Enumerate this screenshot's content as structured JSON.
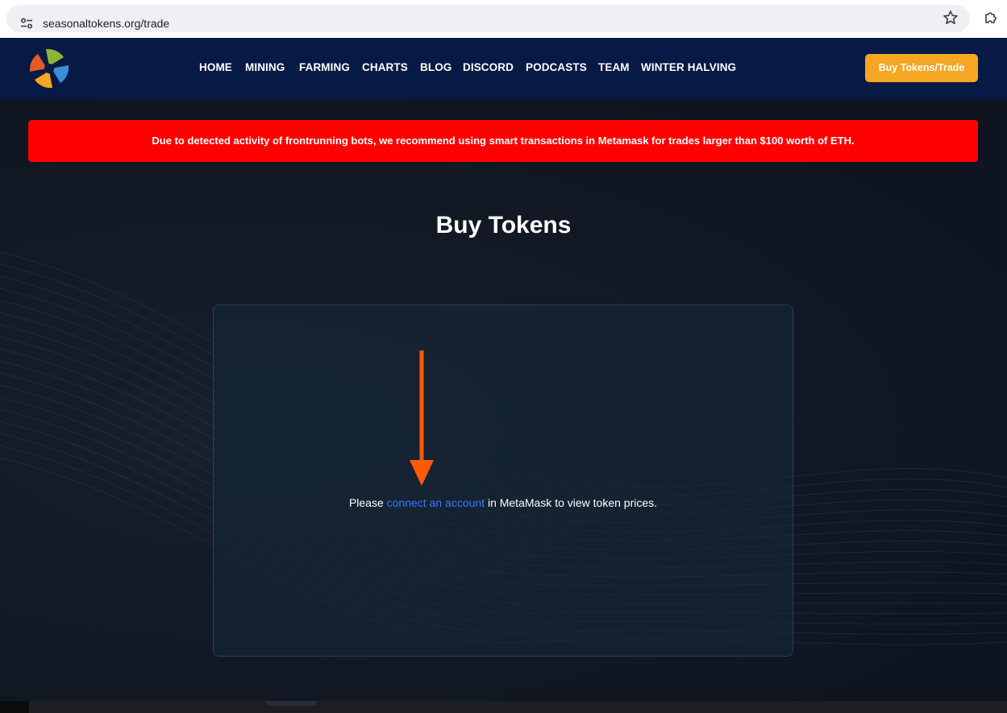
{
  "browser": {
    "url": "seasonaltokens.org/trade"
  },
  "header": {
    "nav": [
      {
        "label": "HOME"
      },
      {
        "label": "MINING"
      },
      {
        "label": "FARMING"
      },
      {
        "label": "CHARTS"
      },
      {
        "label": "BLOG"
      },
      {
        "label": "DISCORD"
      },
      {
        "label": "PODCASTS"
      },
      {
        "label": "TEAM"
      },
      {
        "label": "WINTER HALVING"
      }
    ],
    "cta_label": "Buy Tokens/Trade"
  },
  "alert": {
    "text": "Due to detected activity of frontrunning bots, we recommend using smart transactions in Metamask for trades larger than $100 worth of ETH."
  },
  "main": {
    "title": "Buy Tokens",
    "message_prefix": "Please ",
    "message_link": "connect an account",
    "message_suffix": " in MetaMask to view token prices."
  },
  "colors": {
    "header_bg": "#071a45",
    "cta_bg": "#f5a623",
    "alert_bg": "#ff0000",
    "link": "#2e7bff",
    "annotation_arrow": "#ff5a0a"
  },
  "icons": [
    "site-info-icon",
    "bookmark-star-icon",
    "extensions-icon",
    "seasonal-tokens-logo",
    "annotation-arrow-down"
  ]
}
